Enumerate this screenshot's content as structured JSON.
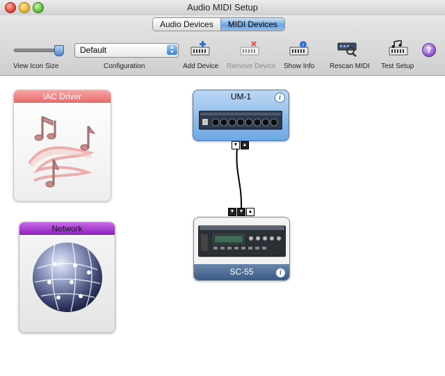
{
  "window": {
    "title": "Audio MIDI Setup"
  },
  "tabs": [
    {
      "label": "Audio Devices",
      "selected": false
    },
    {
      "label": "MIDI Devices",
      "selected": true
    }
  ],
  "toolbar": {
    "view_icon_size_label": "View Icon Size",
    "view_icon_size_level": 1.0,
    "configuration": {
      "label": "Configuration",
      "value": "Default"
    },
    "add_device_label": "Add Device",
    "remove_device_label": "Remove Device",
    "show_info_label": "Show Info",
    "rescan_midi_label": "Rescan MIDI",
    "test_setup_label": "Test Setup",
    "help_label": "?"
  },
  "devices": {
    "iac_driver": {
      "name": "IAC Driver",
      "header_color": "#e86a6a"
    },
    "network": {
      "name": "Network",
      "header_color": "#8e1fc0"
    },
    "um1": {
      "name": "UM-1",
      "info": "i",
      "color": "#6da7e3"
    },
    "sc55": {
      "name": "SC-55",
      "info": "i"
    }
  },
  "ports": {
    "um1": [
      "▼",
      "▲"
    ],
    "sc55": [
      "▼",
      "▼",
      "▲"
    ]
  },
  "colors": {
    "accent": "#6ea5dd",
    "midi_footer": "#3b5a85"
  }
}
